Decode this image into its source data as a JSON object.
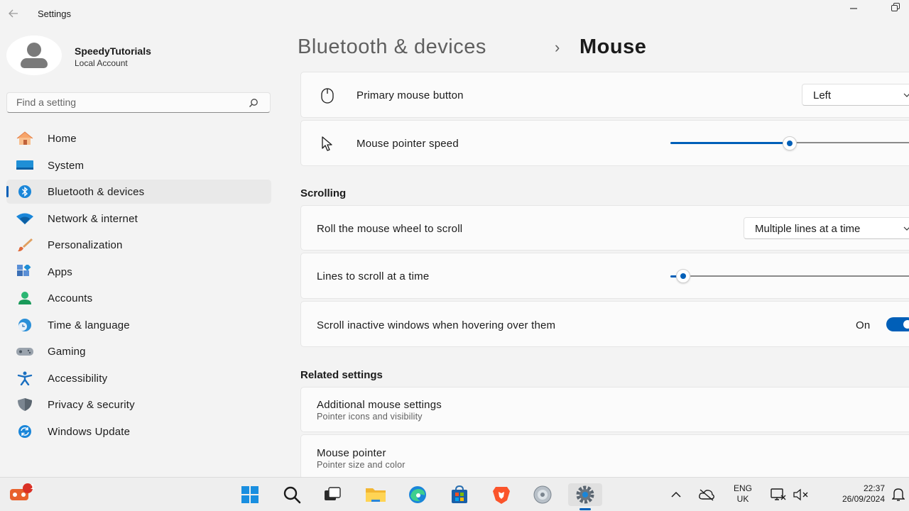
{
  "window": {
    "title": "Settings"
  },
  "user": {
    "name": "SpeedyTutorials",
    "account_type": "Local Account"
  },
  "search": {
    "placeholder": "Find a setting"
  },
  "nav": {
    "items": [
      {
        "label": "Home",
        "icon": "home-icon"
      },
      {
        "label": "System",
        "icon": "system-icon"
      },
      {
        "label": "Bluetooth & devices",
        "icon": "bluetooth-icon",
        "selected": true
      },
      {
        "label": "Network & internet",
        "icon": "wifi-icon"
      },
      {
        "label": "Personalization",
        "icon": "brush-icon"
      },
      {
        "label": "Apps",
        "icon": "apps-icon"
      },
      {
        "label": "Accounts",
        "icon": "accounts-icon"
      },
      {
        "label": "Time & language",
        "icon": "clock-globe-icon"
      },
      {
        "label": "Gaming",
        "icon": "gamepad-icon"
      },
      {
        "label": "Accessibility",
        "icon": "accessibility-icon"
      },
      {
        "label": "Privacy & security",
        "icon": "shield-icon"
      },
      {
        "label": "Windows Update",
        "icon": "update-icon"
      }
    ]
  },
  "breadcrumb": {
    "parent": "Bluetooth & devices",
    "separator": "›",
    "current": "Mouse"
  },
  "settings": {
    "primary_button": {
      "label": "Primary mouse button",
      "value": "Left"
    },
    "pointer_speed": {
      "label": "Mouse pointer speed",
      "value_fraction": 0.5
    },
    "scrolling_header": "Scrolling",
    "wheel_scroll": {
      "label": "Roll the mouse wheel to scroll",
      "value": "Multiple lines at a time"
    },
    "lines_to_scroll": {
      "label": "Lines to scroll at a time",
      "value_fraction": 0.03
    },
    "inactive_scroll": {
      "label": "Scroll inactive windows when hovering over them",
      "state": "On"
    },
    "related_header": "Related settings",
    "additional": {
      "label": "Additional mouse settings",
      "sub": "Pointer icons and visibility"
    },
    "pointer": {
      "label": "Mouse pointer",
      "sub": "Pointer size and color"
    }
  },
  "taskbar": {
    "notification_badge": "1",
    "apps": [
      "start-icon",
      "search-icon",
      "task-view-icon",
      "file-explorer-icon",
      "edge-icon",
      "store-icon",
      "brave-icon",
      "disc-icon",
      "settings-icon"
    ],
    "tray": {
      "lang_line1": "ENG",
      "lang_line2": "UK",
      "time": "22:37",
      "date": "26/09/2024"
    }
  },
  "colors": {
    "accent": "#005fb8",
    "background": "#f3f3f3",
    "card": "#fbfbfb"
  }
}
